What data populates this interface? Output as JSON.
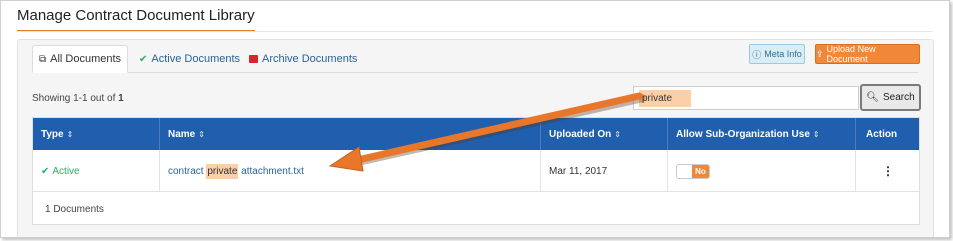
{
  "page": {
    "title": "Manage Contract Document Library"
  },
  "tabs": [
    {
      "label": "All Documents",
      "icon": "copy-icon"
    },
    {
      "label": "Active Documents",
      "icon": "check-icon"
    },
    {
      "label": "Archive Documents",
      "icon": "archive-icon"
    }
  ],
  "toolbar": {
    "meta_label": "Meta Info",
    "upload_label": "Upload New Document"
  },
  "summary": {
    "prefix": "Showing 1-1 out of ",
    "total": "1"
  },
  "search": {
    "value": "private",
    "button_label": "Search"
  },
  "table": {
    "headers": [
      "Type",
      "Name",
      "Uploaded On",
      "Allow Sub-Organization Use",
      "Action"
    ],
    "rows": [
      {
        "type": "Active",
        "name_before": "contract ",
        "name_match": "private",
        "name_after": " attachment.txt",
        "uploaded_on": "Mar 11, 2017",
        "toggle": "No"
      }
    ],
    "footer": "1 Documents"
  },
  "colors": {
    "accent": "#f0883a",
    "header": "#1f5fad",
    "active": "#27ae60",
    "link": "#2a6496"
  }
}
